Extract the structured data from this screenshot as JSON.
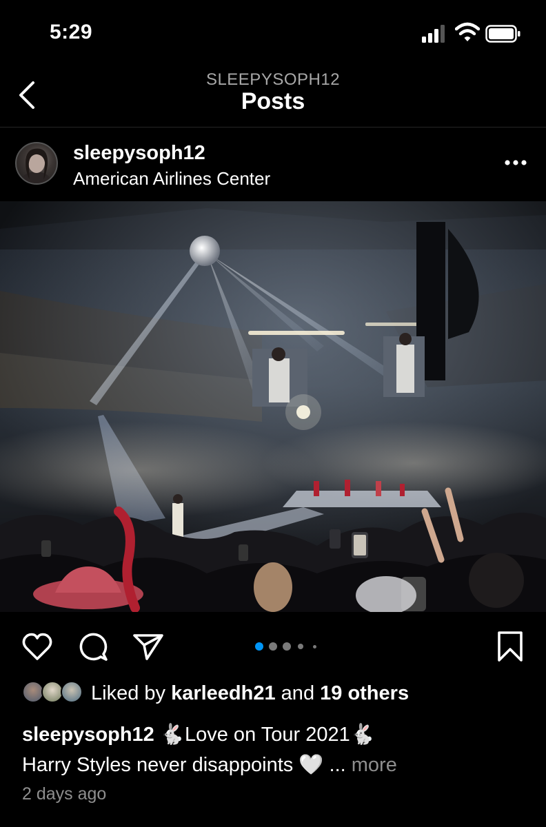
{
  "status_bar": {
    "time": "5:29"
  },
  "nav": {
    "subtitle": "SLEEPYSOPH12",
    "title": "Posts"
  },
  "post": {
    "username": "sleepysoph12",
    "location": "American Airlines Center",
    "carousel": {
      "count": 5,
      "active_index": 0
    },
    "likes": {
      "prefix": "Liked by ",
      "first_liker": "karleedh21",
      "middle": " and ",
      "others": "19 others"
    },
    "caption": {
      "username": "sleepysoph12",
      "line1": " 🐇Love on Tour 2021🐇",
      "line2": "Harry Styles never disappoints 🤍",
      "ellipsis": " ... ",
      "more_label": "more"
    },
    "time_ago": "2 days ago"
  },
  "icons": [
    "back-chevron-icon",
    "signal-icon",
    "wifi-icon",
    "battery-icon",
    "more-options-icon",
    "heart-icon",
    "comment-icon",
    "share-icon",
    "bookmark-icon"
  ],
  "colors": {
    "background": "#000000",
    "text": "#ffffff",
    "muted": "#a8a8a8",
    "active_dot": "#0095f6"
  }
}
